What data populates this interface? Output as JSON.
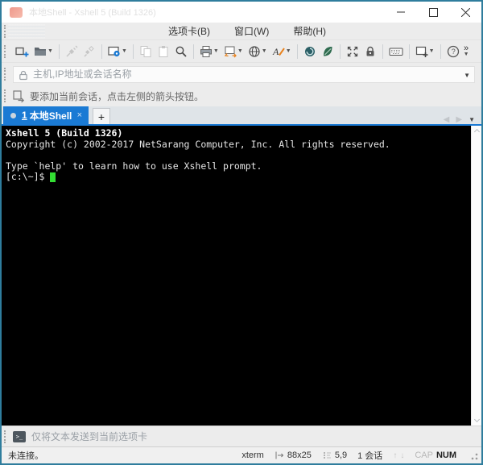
{
  "window": {
    "title": "本地Shell - Xshell 5 (Build 1326)",
    "border_color": "#2f7d9d",
    "control_icons": [
      "minimize-icon",
      "maximize-icon",
      "close-icon"
    ]
  },
  "menu_bar": {
    "items": [
      {
        "label": "选项卡(B)"
      },
      {
        "label": "窗口(W)"
      },
      {
        "label": "帮助(H)"
      }
    ]
  },
  "toolbar": {
    "icons": [
      "new-session-icon",
      "open-folder-icon",
      "connect-icon",
      "disconnect-icon",
      "session-properties-icon",
      "copy-icon",
      "paste-icon",
      "find-icon",
      "print-icon",
      "screen-layout-icon",
      "encoding-globe-icon",
      "font-color-icon",
      "xagent-icon",
      "xftp-icon",
      "fullscreen-icon",
      "lock-screen-icon",
      "virtual-keyboard-icon",
      "new-window-icon",
      "help-icon",
      "overflow-chevron-icon"
    ],
    "overflow_glyph": "»"
  },
  "address_bar": {
    "placeholder": "主机,IP地址或会话名称"
  },
  "info_bar": {
    "message": "要添加当前会话，点击左侧的箭头按钮。"
  },
  "tab_bar": {
    "tabs": [
      {
        "index": "1",
        "label": "本地Shell",
        "active": true,
        "close_glyph": "×"
      }
    ],
    "new_tab_label": "+"
  },
  "terminal": {
    "lines": [
      "Xshell 5 (Build 1326)",
      "Copyright (c) 2002-2017 NetSarang Computer, Inc. All rights reserved.",
      "",
      "Type `help' to learn how to use Xshell prompt."
    ],
    "prompt": "[c:\\~]$",
    "colors": {
      "background": "#000000",
      "text": "#e6e6e6",
      "cursor": "#33dd33"
    }
  },
  "send_bar": {
    "placeholder": "仅将文本发送到当前选项卡"
  },
  "status_bar": {
    "connection": "未连接。",
    "terminal_type": "xterm",
    "grid_size": "88x25",
    "cursor_position": "5,9",
    "session_count": "1 会话",
    "caps_indicator": "CAP",
    "num_indicator": "NUM"
  },
  "colors": {
    "accent_blue": "#1a7ad4",
    "tab_bar_bg": "#dfe4e8"
  }
}
